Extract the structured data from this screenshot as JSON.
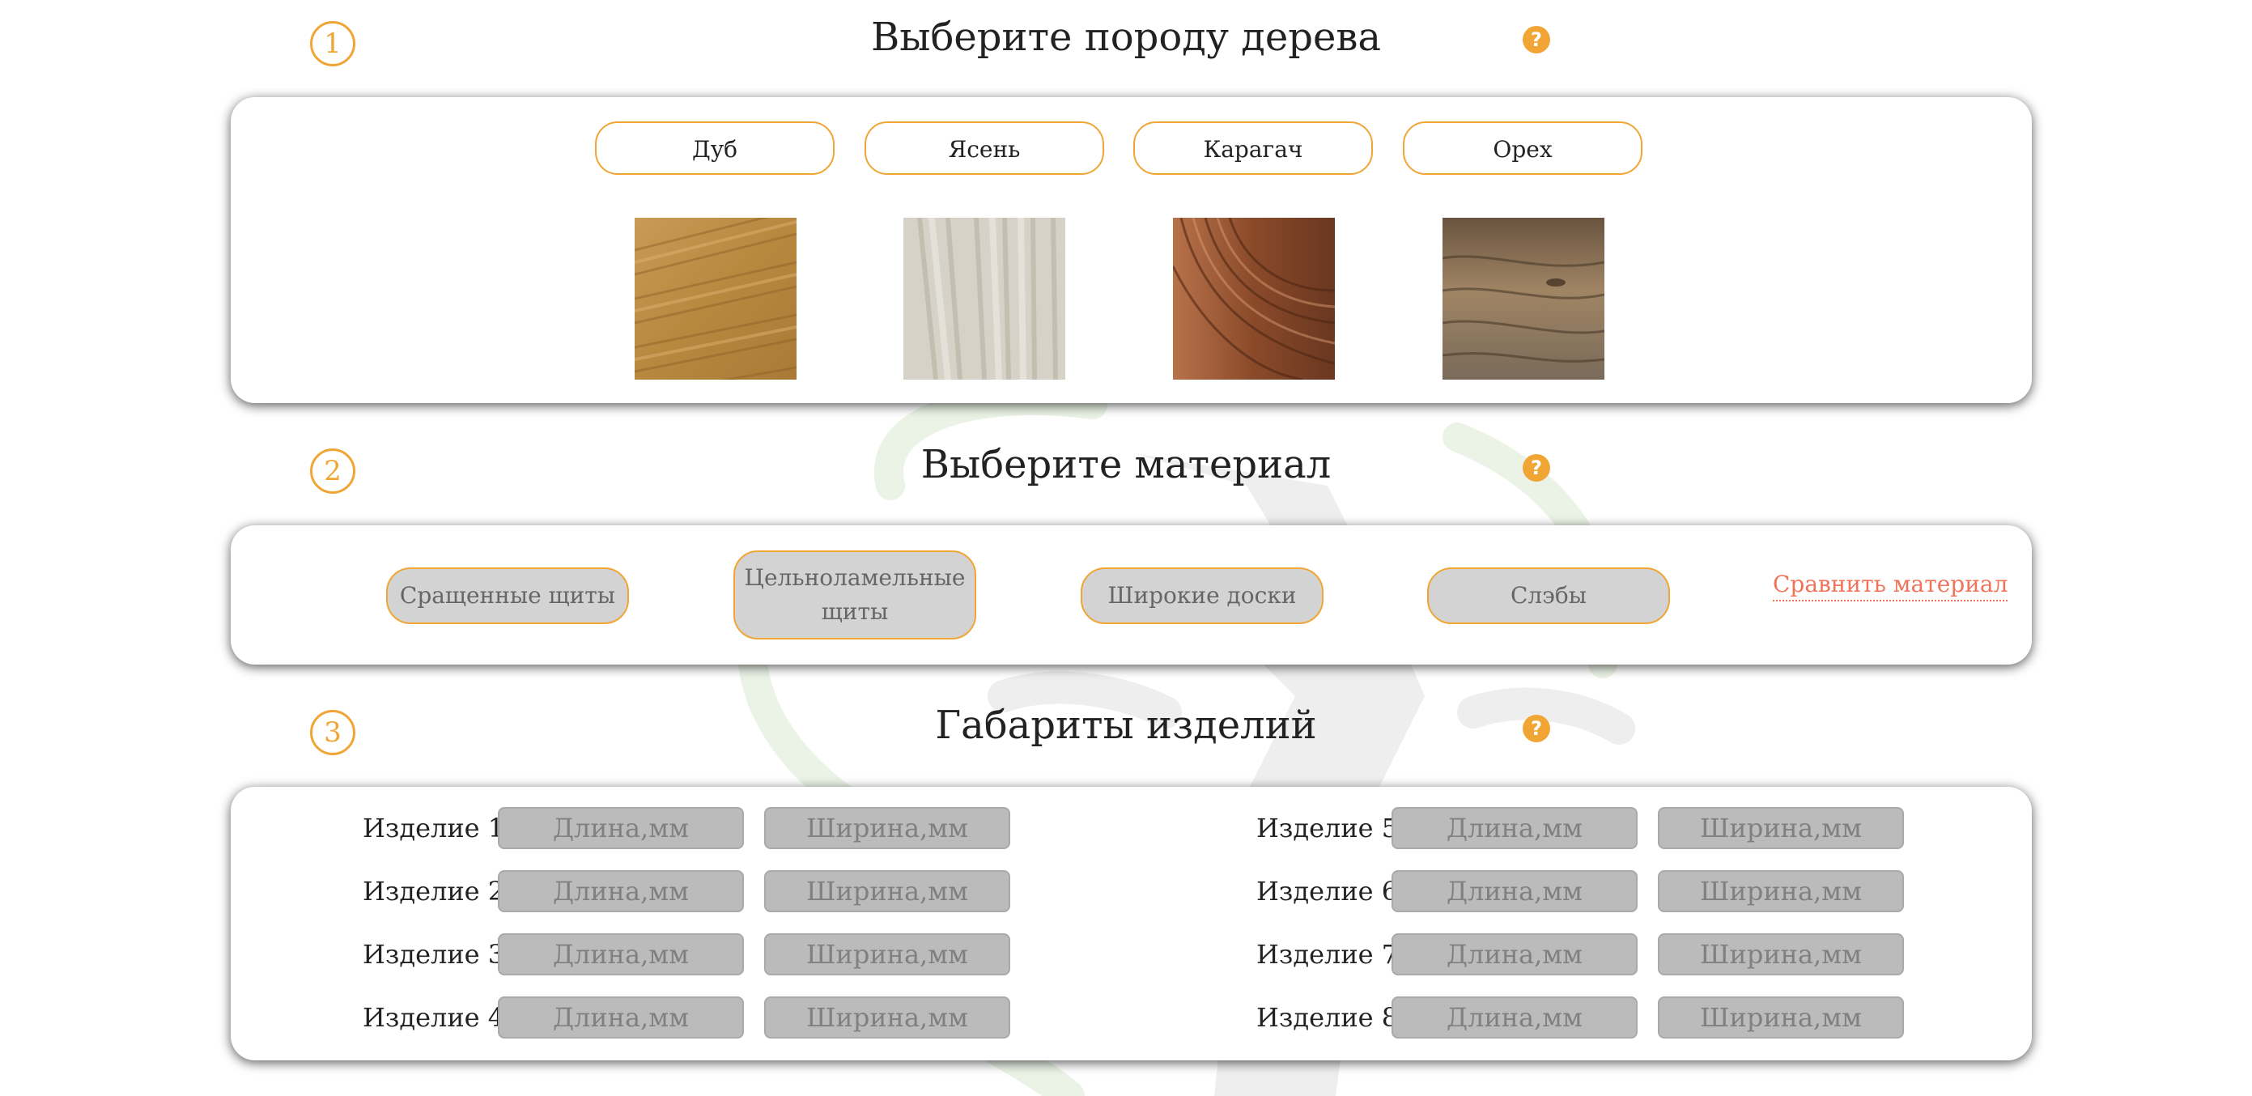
{
  "steps": [
    {
      "number": "1",
      "title": "Выберите породу дерева",
      "help": "?"
    },
    {
      "number": "2",
      "title": "Выберите материал",
      "help": "?"
    },
    {
      "number": "3",
      "title": "Габариты изделий",
      "help": "?"
    }
  ],
  "wood": {
    "buttons": [
      "Дуб",
      "Ясень",
      "Карагач",
      "Орех"
    ]
  },
  "material": {
    "buttons": [
      "Сращенные щиты",
      "Цельноламельные щиты",
      "Широкие доски",
      "Слэбы"
    ],
    "compare_link": "Сравнить материал"
  },
  "dimensions": {
    "length_placeholder": "Длина,мм",
    "width_placeholder": "Ширина,мм",
    "products": [
      "Изделие 1:",
      "Изделие 2:",
      "Изделие 3:",
      "Изделие 4:",
      "Изделие 5:",
      "Изделие 6:",
      "Изделие 7:",
      "Изделие 8:"
    ]
  },
  "colors": {
    "accent": "#f0a535",
    "link": "#f0735a",
    "input_bg": "#bbbbbb",
    "material_bg": "#d3d3d3"
  }
}
